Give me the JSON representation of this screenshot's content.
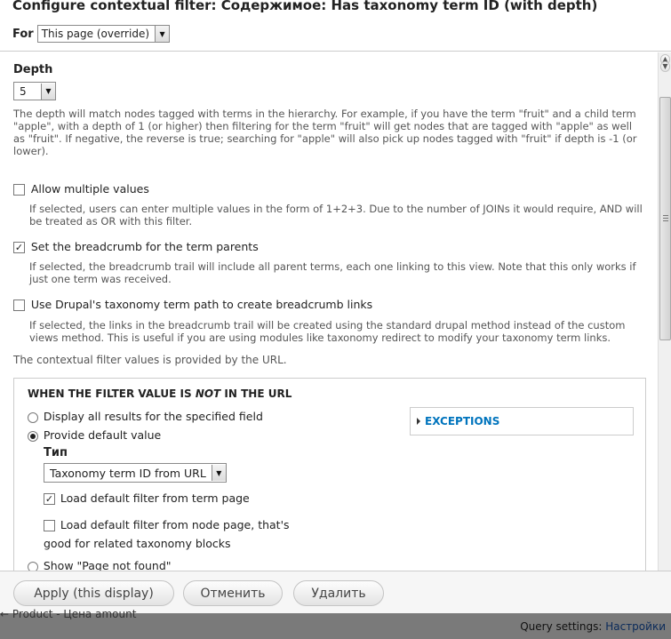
{
  "dialog": {
    "title": "Configure contextual filter: Содержимое: Has taxonomy term ID (with depth)",
    "for_label": "For",
    "for_select": "This page (override)"
  },
  "depth": {
    "label": "Depth",
    "value": "5",
    "description": "The depth will match nodes tagged with terms in the hierarchy. For example, if you have the term \"fruit\" and a child term \"apple\", with a depth of 1 (or higher) then filtering for the term \"fruit\" will get nodes that are tagged with \"apple\" as well as \"fruit\". If negative, the reverse is true; searching for \"apple\" will also pick up nodes tagged with \"fruit\" if depth is -1 (or lower)."
  },
  "options": [
    {
      "label": "Allow multiple values",
      "checked": false,
      "description": "If selected, users can enter multiple values in the form of 1+2+3. Due to the number of JOINs it would require, AND will be treated as OR with this filter."
    },
    {
      "label": "Set the breadcrumb for the term parents",
      "checked": true,
      "description": "If selected, the breadcrumb trail will include all parent terms, each one linking to this view. Note that this only works if just one term was received."
    },
    {
      "label": "Use Drupal's taxonomy term path to create breadcrumb links",
      "checked": false,
      "description": "If selected, the links in the breadcrumb trail will be created using the standard drupal method instead of the custom views method. This is useful if you are using modules like taxonomy redirect to modify your taxonomy term links."
    }
  ],
  "provided_note": "The contextual filter values is provided by the URL.",
  "fieldset": {
    "legend_pre": "WHEN THE FILTER VALUE IS ",
    "legend_em": "NOT",
    "legend_post": " IN THE URL",
    "radios": [
      {
        "label": "Display all results for the specified field",
        "selected": false
      },
      {
        "label": "Provide default value",
        "selected": true
      },
      {
        "label": "Show \"Page not found\"",
        "selected": false
      }
    ],
    "type_label": "Тип",
    "type_select": "Taxonomy term ID from URL",
    "sub_options": [
      {
        "label": "Load default filter from term page",
        "checked": true
      },
      {
        "label_line1": "Load default filter from node page, that's",
        "label_line2": "good for related taxonomy blocks",
        "checked": false
      }
    ],
    "exceptions_label": "EXCEPTIONS"
  },
  "buttons": {
    "apply": "Apply (this display)",
    "cancel": "Отменить",
    "delete": "Удалить"
  },
  "background": {
    "left_link": "← Product - Цена amount",
    "query_settings_label": "Query settings:",
    "query_settings_link": "Настройки"
  },
  "colors": {
    "link": "#0074bd",
    "overlay": "#7a7a7a"
  }
}
